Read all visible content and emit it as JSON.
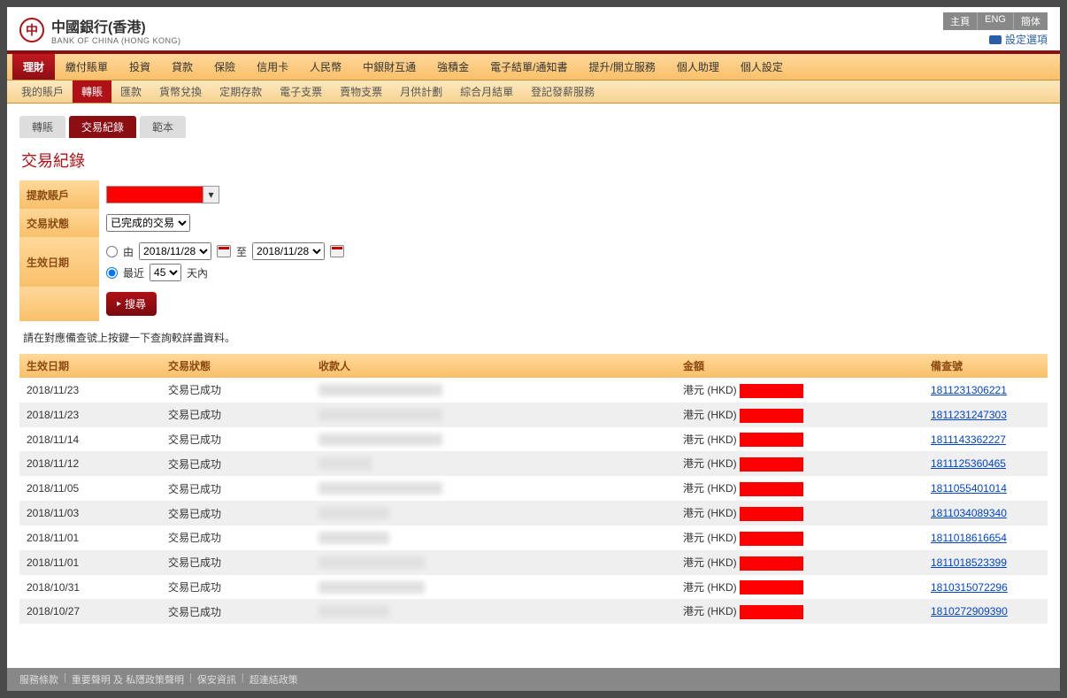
{
  "header": {
    "logo_cn": "中國銀行(香港)",
    "logo_en": "BANK OF CHINA (HONG KONG)",
    "top_links": [
      "主頁",
      "ENG",
      "簡体"
    ],
    "settings_link": "設定選項"
  },
  "nav1": [
    {
      "label": "理財",
      "active": true
    },
    {
      "label": "繳付賬單",
      "active": false
    },
    {
      "label": "投資",
      "active": false
    },
    {
      "label": "貸款",
      "active": false
    },
    {
      "label": "保險",
      "active": false
    },
    {
      "label": "信用卡",
      "active": false
    },
    {
      "label": "人民幣",
      "active": false
    },
    {
      "label": "中銀財互通",
      "active": false
    },
    {
      "label": "強積金",
      "active": false
    },
    {
      "label": "電子結單/通知書",
      "active": false
    },
    {
      "label": "提升/開立服務",
      "active": false
    },
    {
      "label": "個人助理",
      "active": false
    },
    {
      "label": "個人設定",
      "active": false
    }
  ],
  "nav2": [
    {
      "label": "我的賬戶",
      "active": false
    },
    {
      "label": "轉賬",
      "active": true
    },
    {
      "label": "匯款",
      "active": false
    },
    {
      "label": "貨幣兌換",
      "active": false
    },
    {
      "label": "定期存款",
      "active": false
    },
    {
      "label": "電子支票",
      "active": false
    },
    {
      "label": "賣物支票",
      "active": false
    },
    {
      "label": "月供計劃",
      "active": false
    },
    {
      "label": "綜合月結單",
      "active": false
    },
    {
      "label": "登記發薪服務",
      "active": false
    }
  ],
  "subtabs": [
    {
      "label": "轉賬",
      "active": false
    },
    {
      "label": "交易紀錄",
      "active": true
    },
    {
      "label": "範本",
      "active": false
    }
  ],
  "page_title": "交易紀錄",
  "filters": {
    "account_label": "提款賬戶",
    "status_label": "交易狀態",
    "status_options": [
      "已完成的交易"
    ],
    "date_label": "生效日期",
    "from_label": "由",
    "to_label": "至",
    "date_from": "2018/11/28",
    "date_to": "2018/11/28",
    "recent_label": "最近",
    "recent_value": "45",
    "recent_suffix": "天內",
    "search_btn": "搜尋"
  },
  "hint_text": "請在對應備查號上按鍵一下查詢較詳盡資料。",
  "table": {
    "headers": [
      "生效日期",
      "交易狀態",
      "收款人",
      "金額",
      "備查號"
    ],
    "rows": [
      {
        "date": "2018/11/23",
        "status": "交易已成功",
        "blur": "w1",
        "currency": "港元 (HKD)",
        "ref": "1811231306221"
      },
      {
        "date": "2018/11/23",
        "status": "交易已成功",
        "blur": "w1",
        "currency": "港元 (HKD)",
        "ref": "1811231247303"
      },
      {
        "date": "2018/11/14",
        "status": "交易已成功",
        "blur": "w1",
        "currency": "港元 (HKD)",
        "ref": "1811143362227"
      },
      {
        "date": "2018/11/12",
        "status": "交易已成功",
        "blur": "w4",
        "currency": "港元 (HKD)",
        "ref": "1811125360465"
      },
      {
        "date": "2018/11/05",
        "status": "交易已成功",
        "blur": "w1",
        "currency": "港元 (HKD)",
        "ref": "1811055401014"
      },
      {
        "date": "2018/11/03",
        "status": "交易已成功",
        "blur": "w2",
        "currency": "港元 (HKD)",
        "ref": "1811034089340"
      },
      {
        "date": "2018/11/01",
        "status": "交易已成功",
        "blur": "w2",
        "currency": "港元 (HKD)",
        "ref": "1811018616654"
      },
      {
        "date": "2018/11/01",
        "status": "交易已成功",
        "blur": "w3",
        "currency": "港元 (HKD)",
        "ref": "1811018523399"
      },
      {
        "date": "2018/10/31",
        "status": "交易已成功",
        "blur": "w3",
        "currency": "港元 (HKD)",
        "ref": "1810315072296"
      },
      {
        "date": "2018/10/27",
        "status": "交易已成功",
        "blur": "w2",
        "currency": "港元 (HKD)",
        "ref": "1810272909390"
      }
    ]
  },
  "footer": [
    "服務條款",
    "重要聲明 及 私隱政策聲明",
    "保安資訊",
    "超連結政策"
  ]
}
